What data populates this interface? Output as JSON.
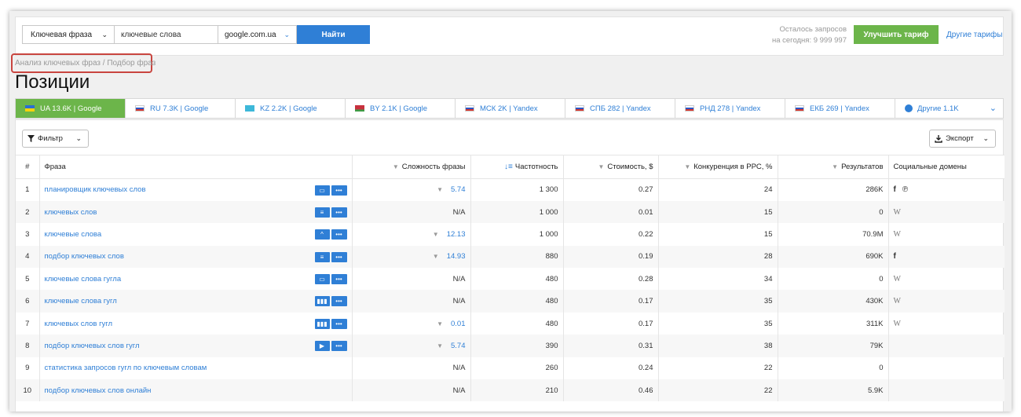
{
  "search": {
    "type_label": "Ключевая фраза",
    "query_value": "ключевые слова",
    "database": "google.com.ua",
    "find_label": "Найти"
  },
  "quota": {
    "line1": "Осталось запросов",
    "line2": "на сегодня: 9 999 997"
  },
  "upgrade_label": "Улучшить тариф",
  "other_plans_label": "Другие тарифы",
  "breadcrumb": "Анализ ключевых фраз / Подбор фраз",
  "page_title": "Позиции",
  "tabs": [
    {
      "label": "UA 13.6K | Google",
      "flag": "ua",
      "active": true
    },
    {
      "label": "RU 7.3K | Google",
      "flag": "ru",
      "active": false
    },
    {
      "label": "KZ 2.2K | Google",
      "flag": "kz",
      "active": false
    },
    {
      "label": "BY 2.1K | Google",
      "flag": "by",
      "active": false
    },
    {
      "label": "МСК 2K | Yandex",
      "flag": "ru",
      "active": false
    },
    {
      "label": "СПБ 282 | Yandex",
      "flag": "ru",
      "active": false
    },
    {
      "label": "РНД 278 | Yandex",
      "flag": "ru",
      "active": false
    },
    {
      "label": "ЕКБ 269 | Yandex",
      "flag": "ru",
      "active": false
    },
    {
      "label": "Другие 1.1K",
      "flag": "globe",
      "active": false
    }
  ],
  "filter_label": "Фильтр",
  "export_label": "Экспорт",
  "columns": [
    "#",
    "Фраза",
    "Сложность фразы",
    "Частотность",
    "Стоимость, $",
    "Конкуренция в PPC, %",
    "Результатов",
    "Социальные домены"
  ],
  "rows": [
    {
      "n": "1",
      "phrase": "планировщик ключевых слов",
      "icons": [
        "chat",
        "dots"
      ],
      "trend": true,
      "difficulty": "5.74",
      "frequency": "1 300",
      "cost": "0.27",
      "competition": "24",
      "results": "286K",
      "social": [
        "f",
        "p"
      ]
    },
    {
      "n": "2",
      "phrase": "ключевых слов",
      "icons": [
        "list",
        "dots"
      ],
      "trend": false,
      "difficulty": "N/A",
      "frequency": "1 000",
      "cost": "0.01",
      "competition": "15",
      "results": "0",
      "social": [
        "w"
      ]
    },
    {
      "n": "3",
      "phrase": "ключевые слова",
      "icons": [
        "grad",
        "dots"
      ],
      "trend": true,
      "difficulty": "12.13",
      "frequency": "1 000",
      "cost": "0.22",
      "competition": "15",
      "results": "70.9M",
      "social": [
        "w"
      ]
    },
    {
      "n": "4",
      "phrase": "подбор ключевых слов",
      "icons": [
        "list",
        "dots"
      ],
      "trend": true,
      "difficulty": "14.93",
      "frequency": "880",
      "cost": "0.19",
      "competition": "28",
      "results": "690K",
      "social": [
        "f"
      ]
    },
    {
      "n": "5",
      "phrase": "ключевые слова гугла",
      "icons": [
        "chat",
        "dots"
      ],
      "trend": false,
      "difficulty": "N/A",
      "frequency": "480",
      "cost": "0.28",
      "competition": "34",
      "results": "0",
      "social": [
        "w"
      ]
    },
    {
      "n": "6",
      "phrase": "ключевые слова гугл",
      "icons": [
        "grid",
        "dots"
      ],
      "trend": false,
      "difficulty": "N/A",
      "frequency": "480",
      "cost": "0.17",
      "competition": "35",
      "results": "430K",
      "social": [
        "w"
      ]
    },
    {
      "n": "7",
      "phrase": "ключевых слов гугл",
      "icons": [
        "grid",
        "dots"
      ],
      "trend": true,
      "difficulty": "0.01",
      "frequency": "480",
      "cost": "0.17",
      "competition": "35",
      "results": "311K",
      "social": [
        "w"
      ]
    },
    {
      "n": "8",
      "phrase": "подбор ключевых слов гугл",
      "icons": [
        "video",
        "dots"
      ],
      "trend": true,
      "difficulty": "5.74",
      "frequency": "390",
      "cost": "0.31",
      "competition": "38",
      "results": "79K",
      "social": []
    },
    {
      "n": "9",
      "phrase": "статистика запросов гугл по ключевым словам",
      "icons": [],
      "trend": false,
      "difficulty": "N/A",
      "frequency": "260",
      "cost": "0.24",
      "competition": "22",
      "results": "0",
      "social": []
    },
    {
      "n": "10",
      "phrase": "подбор ключевых слов онлайн",
      "icons": [],
      "trend": false,
      "difficulty": "N/A",
      "frequency": "210",
      "cost": "0.46",
      "competition": "22",
      "results": "5.9K",
      "social": []
    }
  ]
}
